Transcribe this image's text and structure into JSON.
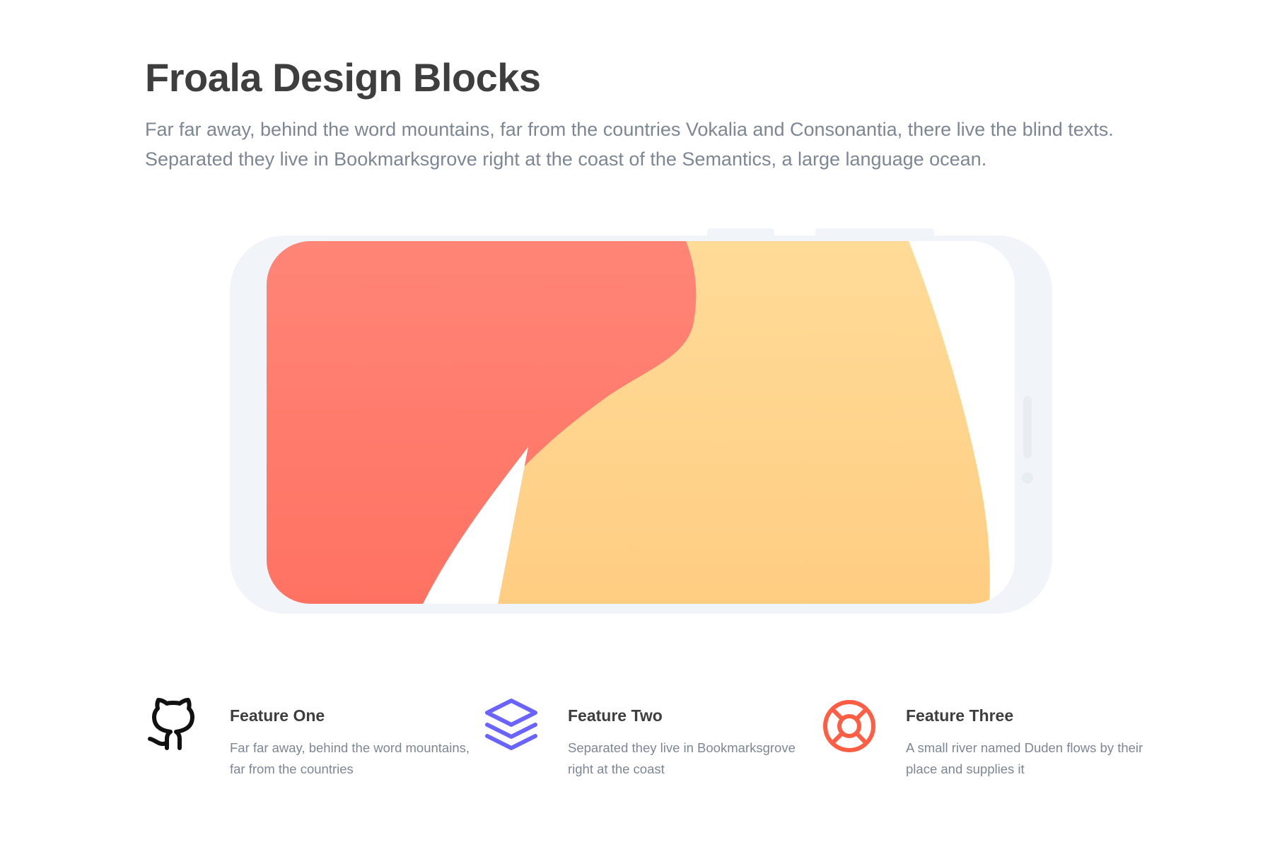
{
  "header": {
    "title": "Froala Design Blocks",
    "lead": "Far far away, behind the word mountains, far from the countries Vokalia and Consonantia, there live the blind texts. Separated they live in Bookmarksgrove right at the coast of the Semantics, a large language ocean."
  },
  "hero": {
    "colors": {
      "frame": "#f1f5f9",
      "screen": "#ffffff",
      "red": "#ff7b6c",
      "yellow": "#ffd28c"
    }
  },
  "features": [
    {
      "icon": "github-icon",
      "icon_color": "#111111",
      "title": "Feature One",
      "text": "Far far away, behind the word mountains, far from the countries"
    },
    {
      "icon": "layers-icon",
      "icon_color": "#6a63ff",
      "title": "Feature Two",
      "text": "Separated they live in Bookmarksgrove right at the coast"
    },
    {
      "icon": "life-ring-icon",
      "icon_color": "#ff5e45",
      "title": "Feature Three",
      "text": "A small river named Duden flows by their place and supplies it"
    }
  ]
}
